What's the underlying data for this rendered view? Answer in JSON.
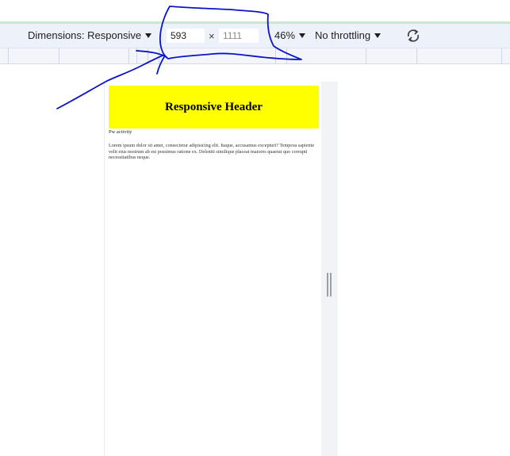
{
  "toolbar": {
    "dimensions_label": "Dimensions: Responsive",
    "width_value": "593",
    "times_symbol": "×",
    "height_placeholder": "1111",
    "zoom_label": "46%",
    "throttling_label": "No throttling",
    "rotate_icon": "rotate-icon"
  },
  "page": {
    "header_title": "Responsive Header",
    "subtitle": "Pw activity",
    "body_text": "Lorem ipsum dolor sit amet, consectetur adipisicing elit. Itaque, accusamus excepturi? Tempora sapiente velit eius nostrum ab est possimus ratione ex. Deleniti similique placeat maiores quaerat quo corrupti necessitatibus neque."
  },
  "colors": {
    "header_background": "#ffff00",
    "annotation_ink": "#0a14c8",
    "toolbar_background": "#edf1f9"
  }
}
